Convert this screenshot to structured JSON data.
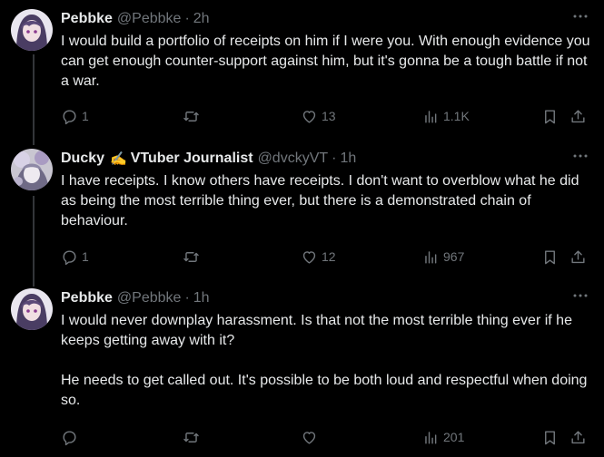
{
  "tweets": [
    {
      "name": "Pebbke",
      "handle": "@Pebbke",
      "dot": "·",
      "time": "2h",
      "paragraphs": [
        "I would build a portfolio of receipts on him if I were you. With enough evidence you can get enough counter-support against him, but it's gonna be a tough battle if not a war."
      ],
      "replies": "1",
      "reposts": "",
      "likes": "13",
      "views": "1.1K"
    },
    {
      "name": "Ducky",
      "name_emoji": "✍️",
      "name_suffix": "VTuber Journalist",
      "handle": "@dvckyVT",
      "dot": "·",
      "time": "1h",
      "paragraphs": [
        "I have receipts. I know others have receipts. I don't want to overblow what he did as being the most terrible thing ever, but there is a demonstrated chain of behaviour."
      ],
      "replies": "1",
      "reposts": "",
      "likes": "12",
      "views": "967"
    },
    {
      "name": "Pebbke",
      "handle": "@Pebbke",
      "dot": "·",
      "time": "1h",
      "paragraphs": [
        "I would never downplay harassment. Is that not the most terrible thing ever if he keeps getting away with it?",
        "He needs to get called out. It's possible to be both loud and respectful when doing so."
      ],
      "replies": "",
      "reposts": "",
      "likes": "",
      "views": "201"
    }
  ],
  "icons": {
    "more": "more-horizontal-icon",
    "reply": "reply-icon",
    "repost": "repost-icon",
    "like": "like-heart-icon",
    "views": "views-chart-icon",
    "bookmark": "bookmark-icon",
    "share": "share-icon"
  },
  "colors": {
    "background": "#000000",
    "text": "#e7e9ea",
    "secondary": "#71767b",
    "thread_line": "#333639"
  }
}
